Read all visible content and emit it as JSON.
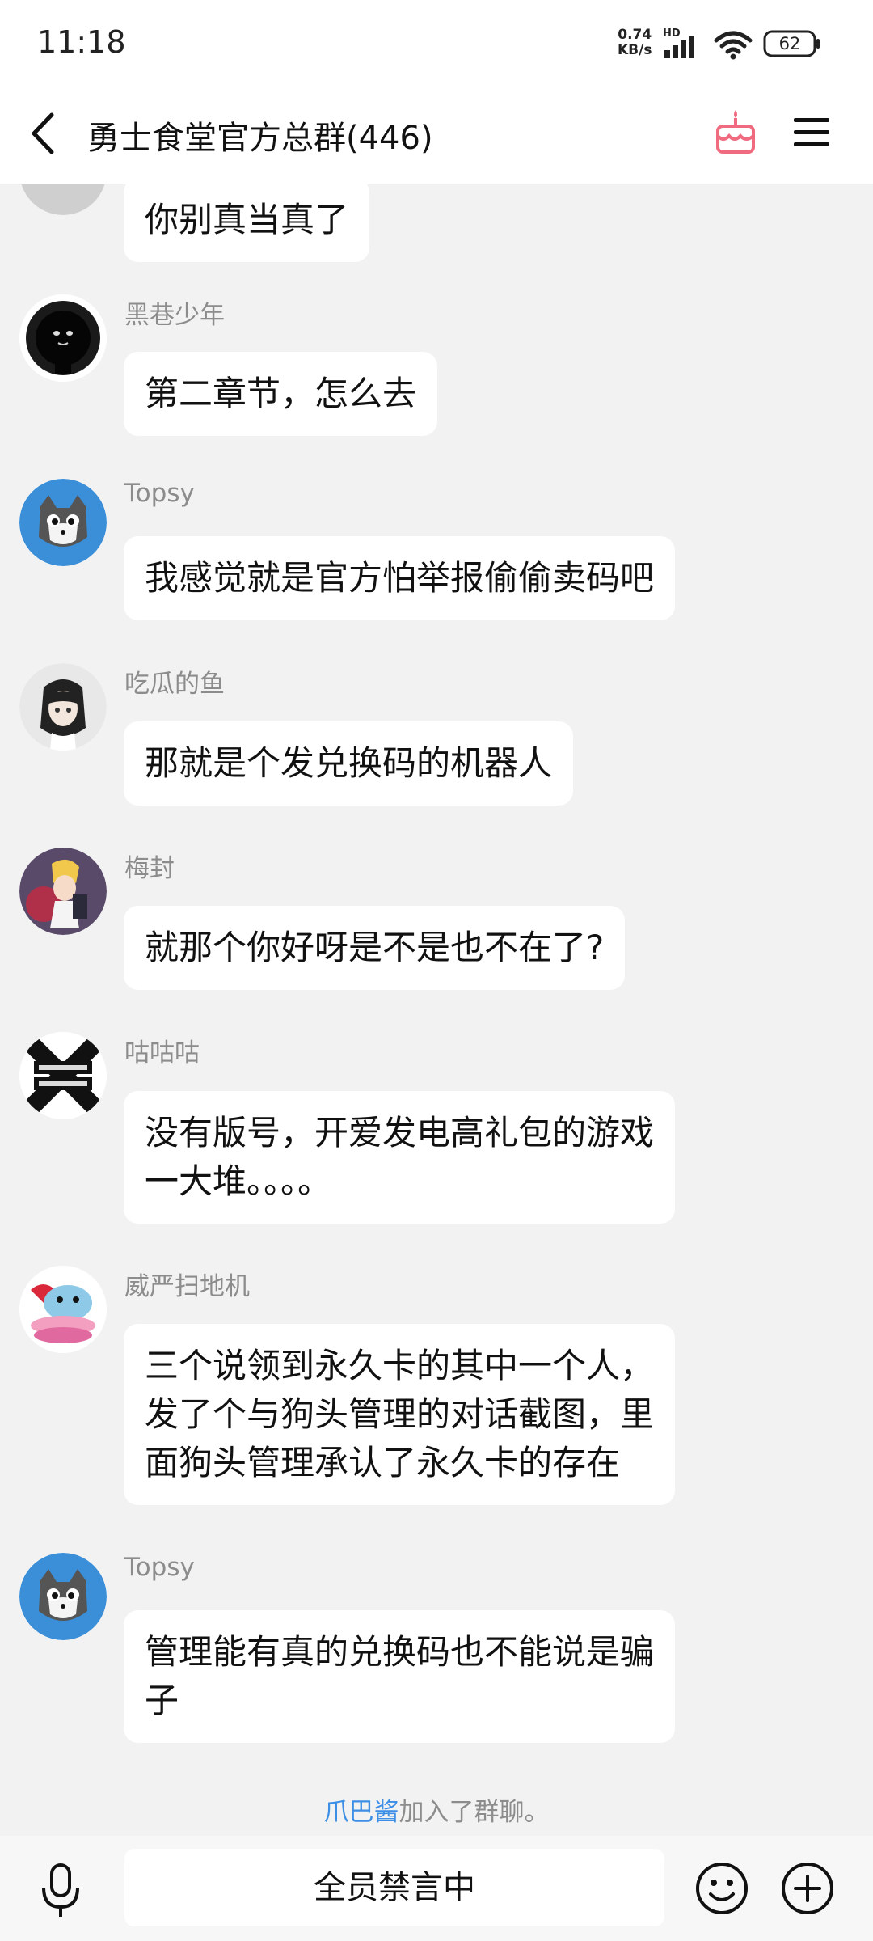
{
  "status_bar": {
    "time": "11:18",
    "net_speed_value": "0.74",
    "net_speed_unit": "KB/s",
    "hd_label": "HD",
    "battery": "62"
  },
  "header": {
    "title": "勇士食堂官方总群(446)"
  },
  "messages": [
    {
      "sender": "",
      "lines": [
        "你别真当真了"
      ]
    },
    {
      "sender": "黑巷少年",
      "lines": [
        "第二章节，怎么去"
      ]
    },
    {
      "sender": "Topsy",
      "lines": [
        "我感觉就是官方怕举报偷偷卖码吧"
      ]
    },
    {
      "sender": "吃瓜的鱼",
      "lines": [
        "那就是个发兑换码的机器人"
      ]
    },
    {
      "sender": "梅封",
      "lines": [
        "就那个你好呀是不是也不在了?"
      ]
    },
    {
      "sender": "咕咕咕",
      "lines": [
        "没有版号，开爱发电高礼包的游戏",
        "一大堆。。。。"
      ]
    },
    {
      "sender": "威严扫地机",
      "lines": [
        "三个说领到永久卡的其中一个人，",
        "发了个与狗头管理的对话截图，里",
        "面狗头管理承认了永久卡的存在"
      ]
    },
    {
      "sender": "Topsy",
      "lines": [
        "管理能有真的兑换码也不能说是骗",
        "子"
      ]
    }
  ],
  "system_message": {
    "user": "爪巴酱",
    "text": "加入了群聊。"
  },
  "input_bar": {
    "mute_text": "全员禁言中"
  },
  "icons": {
    "back": "back-arrow-icon",
    "cake": "birthday-cake-icon",
    "menu": "menu-icon",
    "mic": "microphone-icon",
    "emoji": "emoji-icon",
    "plus": "plus-icon"
  },
  "colors": {
    "link": "#3d8fe6",
    "cake": "#f06a80",
    "background": "#f2f2f2"
  }
}
